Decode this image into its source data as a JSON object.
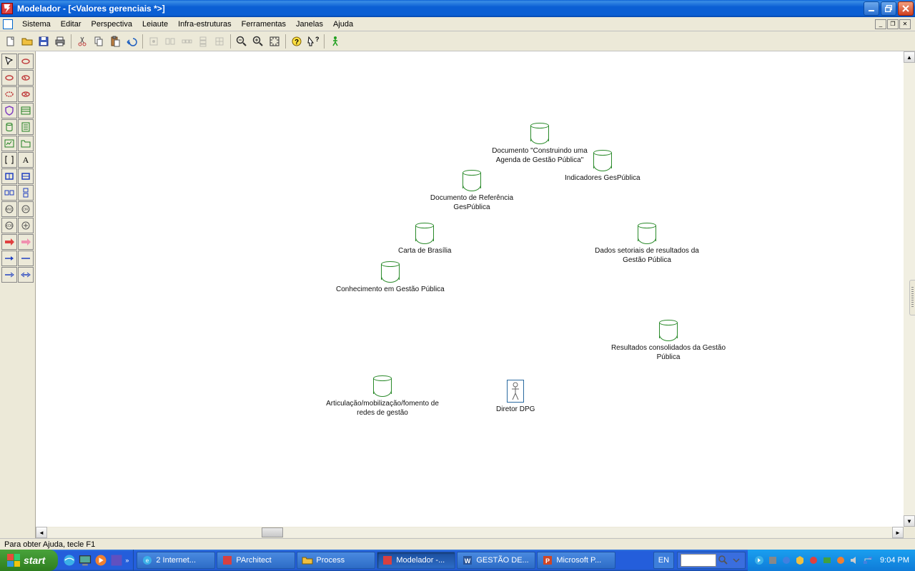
{
  "title": "Modelador - [<Valores gerenciais *>]",
  "menu": {
    "sistema": "Sistema",
    "editar": "Editar",
    "perspectiva": "Perspectiva",
    "leiaute": "Leiaute",
    "infra": "Infra-estruturas",
    "ferramentas": "Ferramentas",
    "janelas": "Janelas",
    "ajuda": "Ajuda"
  },
  "status": "Para obter Ajuda, tecle F1",
  "nodes": {
    "n1": "Documento \"Construindo uma Agenda de Gestão Pública\"",
    "n2": "Indicadores GesPública",
    "n3": "Documento de Referência GesPública",
    "n4": "Carta de Brasília",
    "n5": "Dados setoriais de resultados da Gestão Pública",
    "n6": "Conhecimento em Gestão Pública",
    "n7": "Resultados consolidados da Gestão Pública",
    "n8": "Articulação/mobilização/fomento de redes de gestão",
    "actor": "Diretor DPG"
  },
  "taskbar": {
    "start": "start",
    "t1": "2 Internet...",
    "t2": "PArchitect",
    "t3": "Process",
    "t4": "Modelador -...",
    "t5": "GESTÃO DE...",
    "t6": "Microsoft P...",
    "lang": "EN",
    "time": "9:04 PM"
  }
}
